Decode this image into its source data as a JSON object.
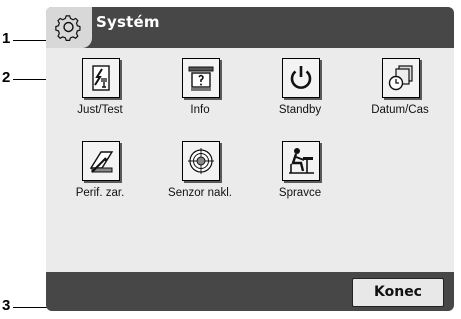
{
  "callouts": [
    "1",
    "2",
    "3"
  ],
  "header": {
    "title": "Systém",
    "icon": "gear-icon"
  },
  "tiles": [
    {
      "label": "Just/Test",
      "icon": "adjust-test-icon"
    },
    {
      "label": "Info",
      "icon": "info-icon"
    },
    {
      "label": "Standby",
      "icon": "power-icon"
    },
    {
      "label": "Datum/Cas",
      "icon": "date-time-icon"
    },
    {
      "label": "Perif. zar.",
      "icon": "peripherals-icon"
    },
    {
      "label": "Senzor nakl.",
      "icon": "level-sensor-icon"
    },
    {
      "label": "Spravce",
      "icon": "administrator-icon"
    }
  ],
  "footer": {
    "button_label": "Konec"
  },
  "colors": {
    "bar": "#474747",
    "panel": "#ebebeb",
    "icon_box": "#d8d8d8"
  }
}
